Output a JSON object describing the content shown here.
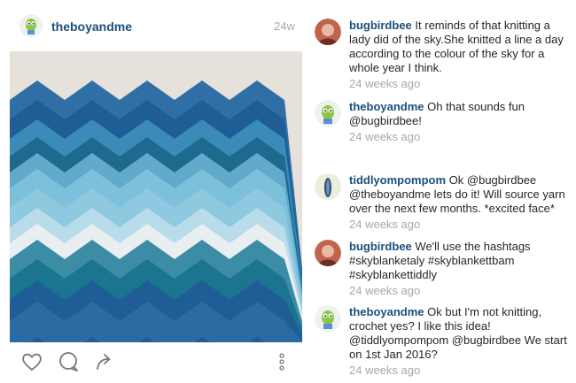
{
  "post": {
    "username": "theboyandme",
    "time_ago": "24w"
  },
  "actions": {
    "like_icon": "heart-outline-icon",
    "comment_icon": "speech-bubble-icon",
    "share_icon": "share-arrow-icon",
    "more_icon": "vertical-ellipsis-icon"
  },
  "comments": [
    {
      "username": "bugbirdbee",
      "text": "It reminds of that knitting a lady did of the sky.She knitted a line a day according to the colour of the sky for a whole year I think.",
      "time": "24 weeks ago"
    },
    {
      "username": "theboyandme",
      "text": "Oh that sounds fun @bugbirdbee!",
      "time": "24 weeks ago"
    },
    {
      "username": "tiddlyompompom",
      "text": "Ok @bugbirdbee @theboyandme lets do it! Will source yarn over the next few months. *excited face*",
      "time": "24 weeks ago"
    },
    {
      "username": "bugbirdbee",
      "text": "We'll use the hashtags #skyblanketaly #skyblankettbam #skyblankettiddly",
      "time": "24 weeks ago"
    },
    {
      "username": "theboyandme",
      "text": "Ok but I'm not knitting, crochet yes? I like this idea! @tiddlyompompom @bugbirdbee We start on 1st Jan 2016?",
      "time": "24 weeks ago"
    }
  ]
}
